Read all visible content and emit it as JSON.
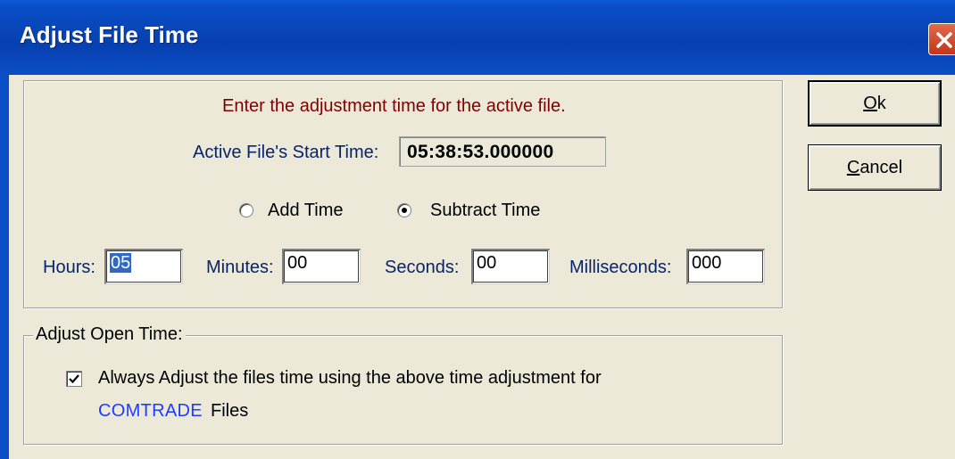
{
  "window": {
    "title": "Adjust File Time",
    "close_icon": "close-icon"
  },
  "main": {
    "instruction": "Enter the adjustment time for the active file.",
    "start_time_label": "Active File's Start Time:",
    "start_time_value": "05:38:53.000000",
    "radio_add_label": "Add Time",
    "radio_subtract_label": "Subtract Time",
    "selected_mode": "Subtract Time",
    "fields": {
      "hours_label": "Hours:",
      "hours_value": "05",
      "minutes_label": "Minutes:",
      "minutes_value": "00",
      "seconds_label": "Seconds:",
      "seconds_value": "00",
      "milliseconds_label": "Milliseconds:",
      "milliseconds_value": "000"
    }
  },
  "open_time": {
    "legend": "Adjust Open Time:",
    "checkbox_checked": true,
    "checkbox_text": "Always Adjust the files time using the above time adjustment for",
    "file_type": "COMTRADE",
    "files_word": "Files"
  },
  "buttons": {
    "ok_mnemonic": "O",
    "ok_rest": "k",
    "cancel_mnemonic": "C",
    "cancel_rest": "ancel"
  },
  "colors": {
    "titlebar": "#0845b8",
    "instruction": "#800000",
    "label_blue": "#0a246a",
    "comtrade_blue": "#1e3cff",
    "dialog_bg": "#ece9d8"
  }
}
